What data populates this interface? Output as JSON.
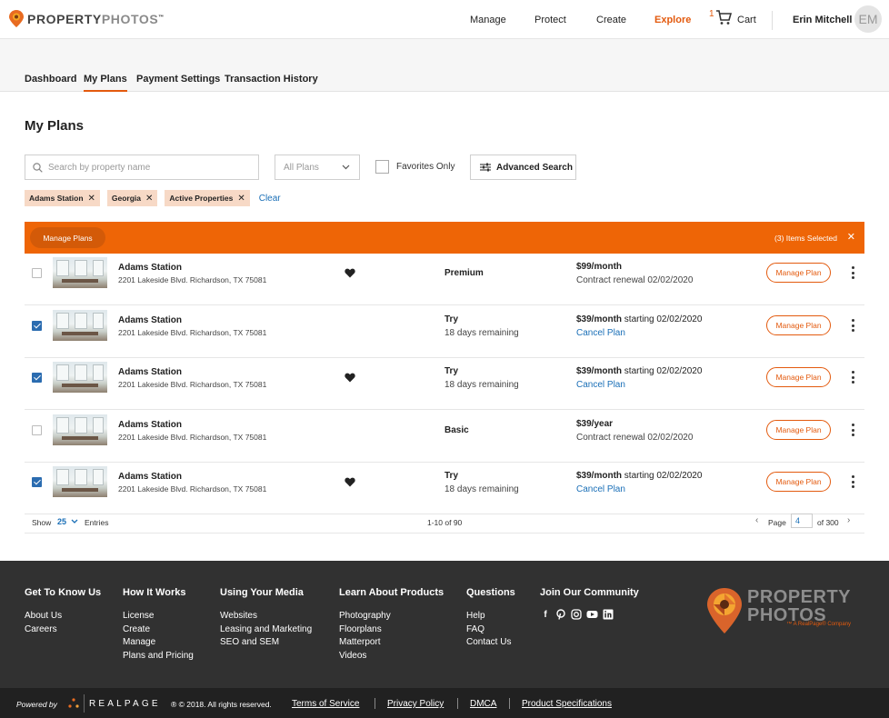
{
  "brand": {
    "name_part1": "PROPERTY",
    "name_part2": "PHOTOS",
    "tm": "™"
  },
  "nav": {
    "items": [
      "Manage",
      "Protect",
      "Create",
      "Explore"
    ],
    "active": "Explore",
    "cart_count": "1",
    "cart_label": "Cart"
  },
  "user": {
    "name": "Erin Mitchell",
    "initials": "EM"
  },
  "subnav": {
    "tabs": [
      "Dashboard",
      "My Plans",
      "Payment Settings",
      "Transaction History"
    ],
    "active": "My Plans"
  },
  "page": {
    "title": "My Plans"
  },
  "filters": {
    "search_placeholder": "Search by property name",
    "plan_select": "All Plans",
    "favorites_label": "Favorites Only",
    "advanced_label": "Advanced Search",
    "chips": [
      "Adams Station",
      "Georgia",
      "Active Properties"
    ],
    "clear_label": "Clear"
  },
  "bulk_bar": {
    "button_label": "Manage Plans",
    "selected_text": "(3) Items Selected",
    "close": "✕"
  },
  "rows": [
    {
      "checked": false,
      "name": "Adams Station",
      "address": "2201 Lakeside Blvd. Richardson, TX 75081",
      "favorite": true,
      "plan": "Premium",
      "plan_sub": "",
      "price_bold": "$99/month",
      "price_rest": "",
      "price_sub": "Contract renewal 02/02/2020",
      "cancel": "",
      "action": "Manage Plan"
    },
    {
      "checked": true,
      "name": "Adams Station",
      "address": "2201 Lakeside Blvd. Richardson, TX 75081",
      "favorite": false,
      "plan": "Try",
      "plan_sub": "18 days remaining",
      "price_bold": "$39/month",
      "price_rest": " starting 02/02/2020",
      "price_sub": "",
      "cancel": "Cancel Plan",
      "action": "Manage Plan"
    },
    {
      "checked": true,
      "name": "Adams Station",
      "address": "2201 Lakeside Blvd. Richardson, TX 75081",
      "favorite": true,
      "plan": "Try",
      "plan_sub": "18 days remaining",
      "price_bold": "$39/month",
      "price_rest": " starting 02/02/2020",
      "price_sub": "",
      "cancel": "Cancel Plan",
      "action": "Manage Plan"
    },
    {
      "checked": false,
      "name": "Adams Station",
      "address": "2201 Lakeside Blvd. Richardson, TX 75081",
      "favorite": false,
      "plan": "Basic",
      "plan_sub": "",
      "price_bold": "$39/year",
      "price_rest": "",
      "price_sub": "Contract renewal 02/02/2020",
      "cancel": "",
      "action": "Manage Plan"
    },
    {
      "checked": true,
      "name": "Adams Station",
      "address": "2201 Lakeside Blvd. Richardson, TX 75081",
      "favorite": true,
      "plan": "Try",
      "plan_sub": "18 days remaining",
      "price_bold": "$39/month",
      "price_rest": " starting 02/02/2020",
      "price_sub": "",
      "cancel": "Cancel Plan",
      "action": "Manage Plan"
    }
  ],
  "table_footer": {
    "show_label": "Show",
    "show_value": "25",
    "entries_label": "Entries",
    "range": "1-10 of 90",
    "page_label": "Page",
    "page_value": "4",
    "of_label": "of 300"
  },
  "footer": {
    "columns": [
      {
        "title": "Get To Know Us",
        "links": [
          "About Us",
          "Careers"
        ]
      },
      {
        "title": "How It Works",
        "links": [
          "License",
          "Create",
          "Manage",
          "Plans and Pricing"
        ]
      },
      {
        "title": "Using Your Media",
        "links": [
          "Websites",
          "Leasing and Marketing",
          "SEO and SEM"
        ]
      },
      {
        "title": "Learn About Products",
        "links": [
          "Photography",
          "Floorplans",
          "Matterport",
          "Videos"
        ]
      },
      {
        "title": "Questions",
        "links": [
          "Help",
          "FAQ",
          "Contact Us"
        ]
      }
    ],
    "community_title": "Join Our Community",
    "social": [
      "facebook-icon",
      "pinterest-icon",
      "instagram-icon",
      "youtube-icon",
      "linkedin-icon"
    ],
    "logo_line1": "PROPERTY",
    "logo_line2": "PHOTOS",
    "logo_tagline": "™ A RealPage® Company"
  },
  "bottom": {
    "powered": "Powered by",
    "realpage": "REALPAGE",
    "copyright": "® © 2018. All rights reserved.",
    "links": [
      "Terms of Service",
      "Privacy Policy",
      "DMCA",
      "Product Specifications"
    ]
  },
  "colors": {
    "accent": "#ee6506",
    "link": "#1a6fb7",
    "footer_bg": "#313131"
  }
}
